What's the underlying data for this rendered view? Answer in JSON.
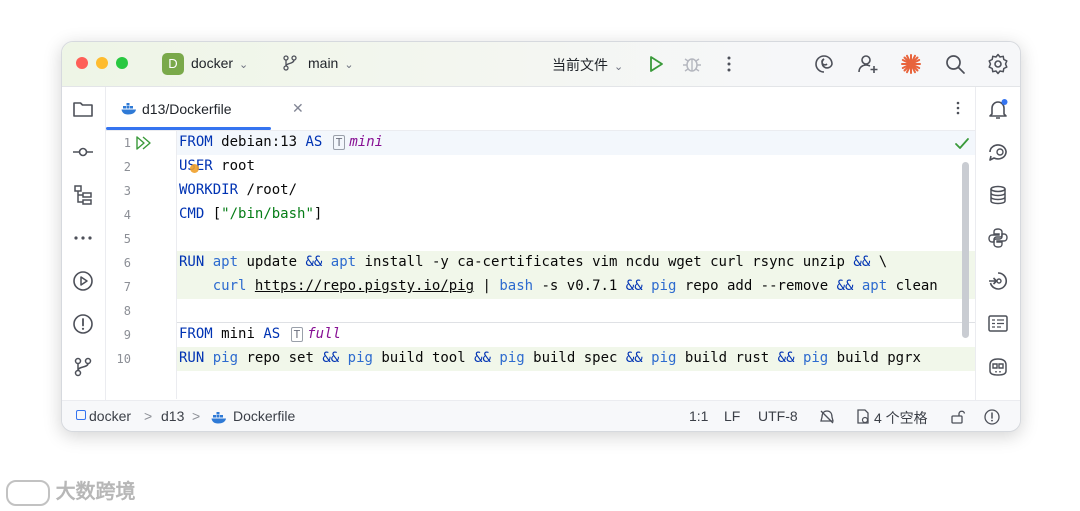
{
  "titlebar": {
    "project_initial": "D",
    "project_name": "docker",
    "branch_name": "main",
    "run_config": "当前文件"
  },
  "tab": {
    "title": "d13/Dockerfile"
  },
  "editor": {
    "line_numbers": [
      "1",
      "2",
      "3",
      "4",
      "5",
      "6",
      "7",
      "8",
      "9",
      "10"
    ],
    "lines": {
      "l1_from": "FROM",
      "l1_image": "debian:13",
      "l1_as": "AS",
      "l1_alias": "mini",
      "l2_kw": "USER",
      "l2_arg": "root",
      "l3_kw": "WORKDIR",
      "l3_arg": "/root/",
      "l4_kw": "CMD",
      "l4_open": "[",
      "l4_str": "\"/bin/bash\"",
      "l4_close": "]",
      "l6_run": "RUN",
      "l6_apt1": "apt",
      "l6_update": "update",
      "l6_and1": "&&",
      "l6_apt2": "apt",
      "l6_install": "install -y ca-certificates vim ncdu wget curl rsync unzip",
      "l6_and2": "&&",
      "l6_cont": "\\",
      "l7_curl": "curl",
      "l7_url": "https://repo.pigsty.io/pig",
      "l7_pipe": "|",
      "l7_bash": "bash",
      "l7_args": "-s v0.7.1",
      "l7_and1": "&&",
      "l7_pig": "pig",
      "l7_repo": "repo add --remove",
      "l7_and2": "&&",
      "l7_apt": "apt",
      "l7_clean": "clean",
      "l9_from": "FROM",
      "l9_image": "mini",
      "l9_as": "AS",
      "l9_alias": "full",
      "l10_run": "RUN",
      "l10_pig1": "pig",
      "l10_a1": "repo set",
      "l10_and1": "&&",
      "l10_pig2": "pig",
      "l10_a2": "build tool",
      "l10_and2": "&&",
      "l10_pig3": "pig",
      "l10_a3": "build spec",
      "l10_and3": "&&",
      "l10_pig4": "pig",
      "l10_a4": "build rust",
      "l10_and4": "&&",
      "l10_pig5": "pig",
      "l10_a5": "build pgrx"
    }
  },
  "statusbar": {
    "crumb_project": "docker",
    "crumb_folder": "d13",
    "crumb_file": "Dockerfile",
    "sep": ">",
    "position": "1:1",
    "line_sep": "LF",
    "encoding": "UTF-8",
    "indent": "4 个空格"
  },
  "watermark": "大数跨境",
  "colors": {
    "accent": "#3574f0",
    "keyword": "#0033b3",
    "string": "#067d17",
    "alias": "#871094",
    "run_green": "#4e9a06",
    "project_badge": "#7aa94a"
  },
  "icons": [
    "folder-icon",
    "commit-icon",
    "structure-icon",
    "more-icon",
    "run-icon",
    "problems-icon",
    "git-icon",
    "bell-icon",
    "ai-chat-icon",
    "database-icon",
    "python-icon",
    "services-icon",
    "terminal-icon",
    "copilot-icon",
    "debug-icon",
    "kebab-icon",
    "swirl-icon",
    "add-user-icon",
    "sparkle-icon",
    "search-icon",
    "settings-icon",
    "check-icon",
    "branch-icon",
    "docker-icon",
    "lock-icon",
    "warning-icon"
  ]
}
